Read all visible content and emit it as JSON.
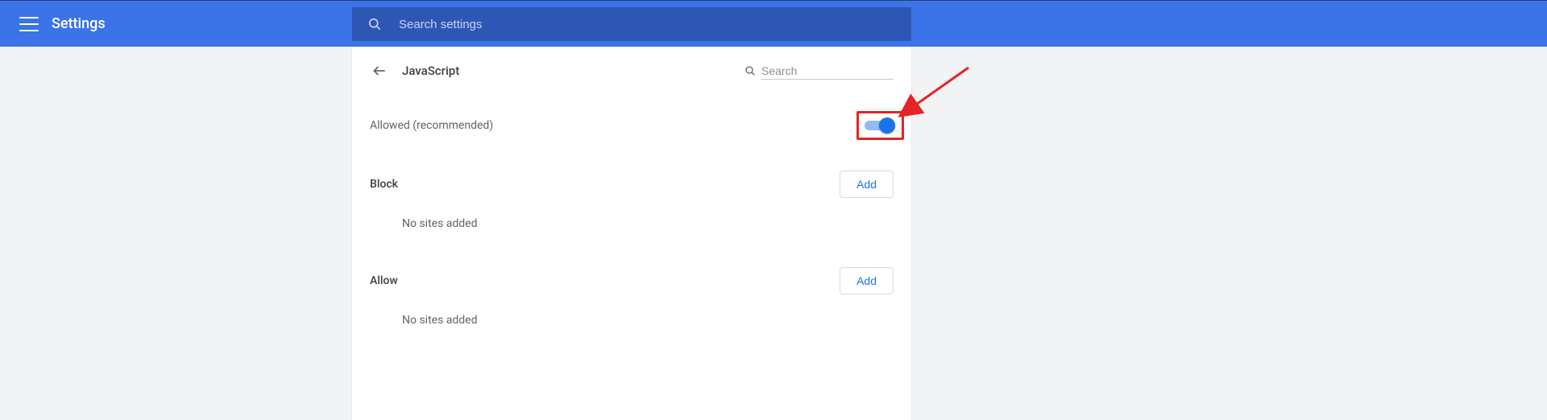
{
  "header": {
    "title": "Settings",
    "search_placeholder": "Search settings"
  },
  "page": {
    "title": "JavaScript",
    "search_placeholder": "Search"
  },
  "setting": {
    "label": "Allowed (recommended)",
    "toggle_on": true
  },
  "sections": {
    "block": {
      "title": "Block",
      "add_label": "Add",
      "empty_msg": "No sites added"
    },
    "allow": {
      "title": "Allow",
      "add_label": "Add",
      "empty_msg": "No sites added"
    }
  },
  "colors": {
    "header_bg": "#3b73e8",
    "header_search_bg": "#2e57b5",
    "accent": "#1a73e8",
    "annotation": "#e52426"
  }
}
